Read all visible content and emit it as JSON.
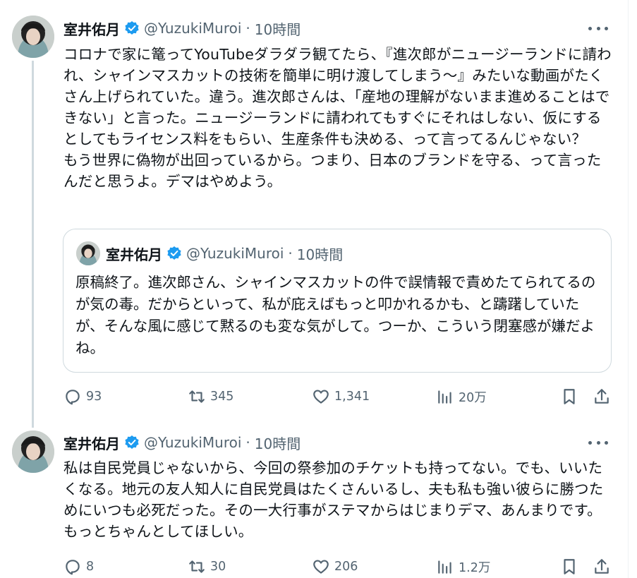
{
  "tweets": [
    {
      "name": "室井佑月",
      "handle": "@YuzukiMuroi",
      "separator": "·",
      "time": "10時間",
      "text": "コロナで家に篭ってYouTubeダラダラ観てたら、『進次郎がニュージーランドに請われ、シャインマスカットの技術を簡単に明け渡してしまう〜』みたいな動画がたくさん上げられていた。違う。進次郎さんは、「産地の理解がないまま進めることはできない」と言った。ニュージーランドに請われてもすぐにそれはしない、仮にするとしてもライセンス料をもらい、生産条件も決める、って言ってるんじゃない？　もう世界に偽物が出回っているから。つまり、日本のブランドを守る、って言ったんだと思うよ。デマはやめよう。",
      "quote": {
        "name": "室井佑月",
        "handle": "@YuzukiMuroi",
        "separator": "·",
        "time": "10時間",
        "text": "原稿終了。進次郎さん、シャインマスカットの件で誤情報で責めたてられてるのが気の毒。だからといって、私が庇えばもっと叩かれるかも、と躊躇していたが、そんな風に感じて黙るのも変な気がして。つーか、こういう閉塞感が嫌だよね。"
      },
      "stats": {
        "replies": "93",
        "retweets": "345",
        "likes": "1,341",
        "views": "20万"
      }
    },
    {
      "name": "室井佑月",
      "handle": "@YuzukiMuroi",
      "separator": "·",
      "time": "10時間",
      "text": "私は自民党員じゃないから、今回の祭参加のチケットも持ってない。でも、いいたくなる。地元の友人知人に自民党員はたくさんいるし、夫も私も強い彼らに勝つためにいつも必死だった。その一大行事がステマからはじまりデマ、あんまりです。もっとちゃんとしてほしい。",
      "stats": {
        "replies": "8",
        "retweets": "30",
        "likes": "206",
        "views": "1.2万"
      }
    }
  ],
  "colors": {
    "text": "#0f1419",
    "secondary": "#536471",
    "verified": "#1d9bf0",
    "border": "#cfd9de"
  },
  "icons": [
    "verified-badge-icon",
    "more-icon",
    "reply-icon",
    "retweet-icon",
    "like-icon",
    "views-icon",
    "bookmark-icon",
    "share-icon"
  ]
}
